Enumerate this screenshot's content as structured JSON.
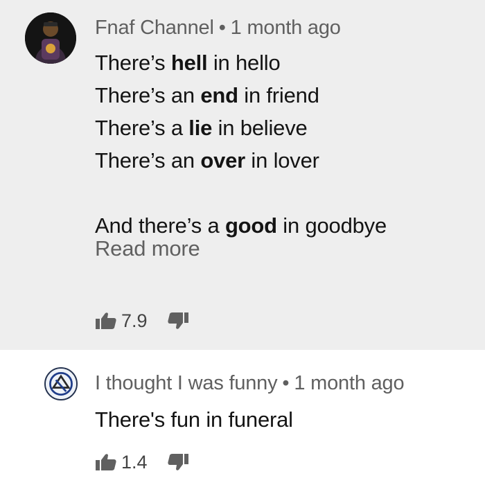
{
  "comments": [
    {
      "author": "Fnaf Channel",
      "separator": "•",
      "time": "1 month ago",
      "lines": [
        {
          "pre": "There’s ",
          "bold": "hell",
          "post": " in hello"
        },
        {
          "pre": "There’s an ",
          "bold": "end",
          "post": " in friend"
        },
        {
          "pre": "There’s a ",
          "bold": "lie",
          "post": " in believe"
        },
        {
          "pre": "There’s an ",
          "bold": "over",
          "post": " in lover"
        },
        {
          "pre": "And there’s a ",
          "bold": "good",
          "post": " in goodbye"
        }
      ],
      "read_more": "Read more",
      "likes": "7.9",
      "avatar_icon": "avatar-character-icon"
    },
    {
      "author": "I thought I was funny",
      "separator": "•",
      "time": "1 month ago",
      "text": "There's fun in funeral",
      "likes": "1.4",
      "avatar_icon": "avatar-logo-icon"
    }
  ],
  "icons": {
    "like": "thumbs-up-icon",
    "dislike": "thumbs-down-icon"
  },
  "colors": {
    "first_comment_bg": "#eeeeee",
    "meta_text": "#5f5f5f",
    "body_text": "#141414"
  }
}
